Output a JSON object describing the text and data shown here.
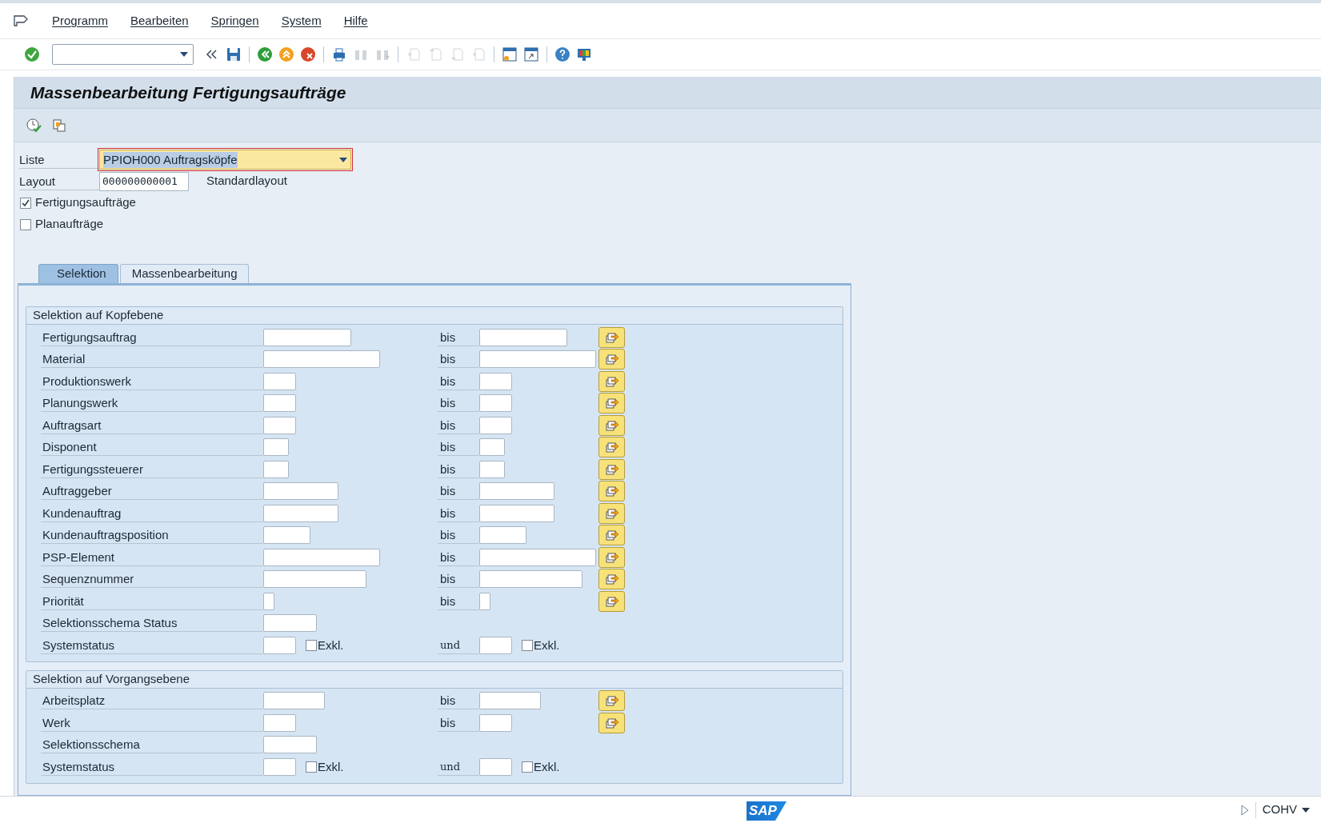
{
  "menu": [
    {
      "label": "Programm"
    },
    {
      "label": "Bearbeiten"
    },
    {
      "label": "Springen"
    },
    {
      "label": "System"
    },
    {
      "label": "Hilfe"
    }
  ],
  "title": "Massenbearbeitung Fertigungsaufträge",
  "header_fields": [
    {
      "kind": "dropdown",
      "label": "Liste",
      "value": "PPIOH000 Auftragsköpfe"
    },
    {
      "kind": "text",
      "label": "Layout",
      "value": "000000000001",
      "description": "Standardlayout"
    }
  ],
  "order_types": [
    {
      "label": "Fertigungsaufträge",
      "checked": true
    },
    {
      "label": "Planaufträge",
      "checked": false
    }
  ],
  "tabs": [
    {
      "label": "Selektion",
      "selected": true
    },
    {
      "label": "Massenbearbeitung",
      "selected": false
    }
  ],
  "groups": [
    {
      "title": "Selektion auf Kopfebene",
      "rows": [
        {
          "kind": "range",
          "label": "Fertigungsauftrag",
          "to_label": "bis"
        },
        {
          "kind": "range",
          "label": "Material",
          "to_label": "bis"
        },
        {
          "kind": "range",
          "label": "Produktionswerk",
          "to_label": "bis"
        },
        {
          "kind": "range",
          "label": "Planungswerk",
          "to_label": "bis"
        },
        {
          "kind": "range",
          "label": "Auftragsart",
          "to_label": "bis"
        },
        {
          "kind": "range",
          "label": "Disponent",
          "to_label": "bis"
        },
        {
          "kind": "range",
          "label": "Fertigungssteuerer",
          "to_label": "bis"
        },
        {
          "kind": "range",
          "label": "Auftraggeber",
          "to_label": "bis"
        },
        {
          "kind": "range",
          "label": "Kundenauftrag",
          "to_label": "bis"
        },
        {
          "kind": "range",
          "label": "Kundenauftragsposition",
          "to_label": "bis"
        },
        {
          "kind": "range",
          "label": "PSP-Element",
          "to_label": "bis"
        },
        {
          "kind": "range",
          "label": "Sequenznummer",
          "to_label": "bis"
        },
        {
          "kind": "range",
          "label": "Priorität",
          "to_label": "bis"
        },
        {
          "kind": "single",
          "label": "Selektionsschema Status"
        },
        {
          "kind": "status",
          "label": "Systemstatus",
          "exclude_label": "Exkl.",
          "exclude": false,
          "and_label": "und",
          "exclude_label_2": "Exkl.",
          "exclude_2": false
        }
      ]
    },
    {
      "title": "Selektion auf Vorgangsebene",
      "rows": [
        {
          "kind": "range",
          "label": "Arbeitsplatz",
          "to_label": "bis"
        },
        {
          "kind": "range",
          "label": "Werk",
          "to_label": "bis"
        },
        {
          "kind": "single",
          "label": "Selektionsschema"
        },
        {
          "kind": "status",
          "label": "Systemstatus",
          "exclude_label": "Exkl.",
          "exclude": false,
          "and_label": "und",
          "exclude_label_2": "Exkl.",
          "exclude_2": false
        }
      ]
    }
  ],
  "status_bar": {
    "logo": "SAP",
    "transaction": "COHV"
  }
}
